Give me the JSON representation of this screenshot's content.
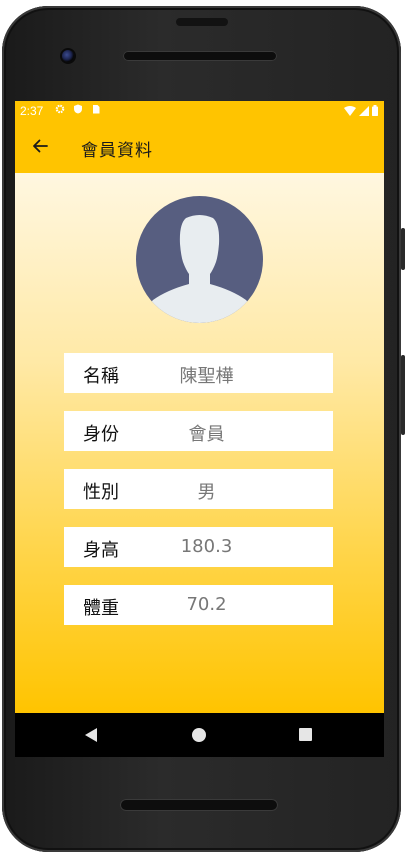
{
  "status_bar": {
    "time": "2:37",
    "left_icons": [
      "gear-icon",
      "shield-icon",
      "sim-card-icon"
    ],
    "right_icons": [
      "wifi-icon",
      "signal-icon",
      "battery-icon"
    ]
  },
  "app_bar": {
    "back_icon": "arrow-left-icon",
    "title": "會員資料"
  },
  "profile": {
    "avatar_icon": "person-silhouette-icon",
    "fields": [
      {
        "label": "名稱",
        "value": "陳聖樺"
      },
      {
        "label": "身份",
        "value": "會員"
      },
      {
        "label": "性別",
        "value": "男"
      },
      {
        "label": "身高",
        "value": "180.3"
      },
      {
        "label": "體重",
        "value": "70.2"
      }
    ]
  },
  "colors": {
    "accent": "#ffc400",
    "avatar_bg": "#575e80",
    "avatar_fg": "#e8edf0"
  },
  "nav_bar": {
    "buttons": [
      "back-triangle-icon",
      "home-circle-icon",
      "recents-square-icon"
    ]
  }
}
